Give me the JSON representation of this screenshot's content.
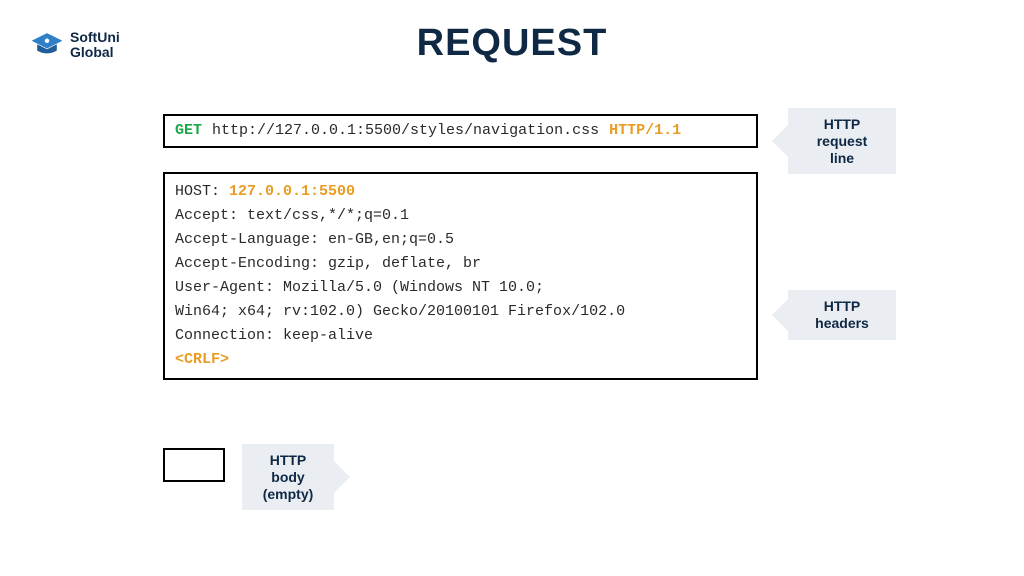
{
  "brand": {
    "line1": "SoftUni",
    "line2": "Global"
  },
  "title": "REQUEST",
  "request_line": {
    "method": "GET",
    "url": "http://127.0.0.1:5500/styles/navigation.css",
    "version": "HTTP/1.1"
  },
  "headers": {
    "host_label": "HOST: ",
    "host_value": "127.0.0.1:5500",
    "lines": [
      "Accept: text/css,*/*;q=0.1",
      "Accept-Language: en-GB,en;q=0.5",
      "Accept-Encoding: gzip, deflate, br",
      "User-Agent: Mozilla/5.0 (Windows NT 10.0;",
      "Win64; x64; rv:102.0) Gecko/20100101 Firefox/102.0",
      "Connection: keep-alive"
    ],
    "crlf": "<CRLF>"
  },
  "callouts": {
    "request_line": "HTTP request\nline",
    "headers": "HTTP headers",
    "body": "HTTP body\n(empty)"
  },
  "colors": {
    "method": "#1aa64a",
    "accent": "#e99b22",
    "ink": "#0f2844",
    "callout_bg": "#eaeef2"
  }
}
